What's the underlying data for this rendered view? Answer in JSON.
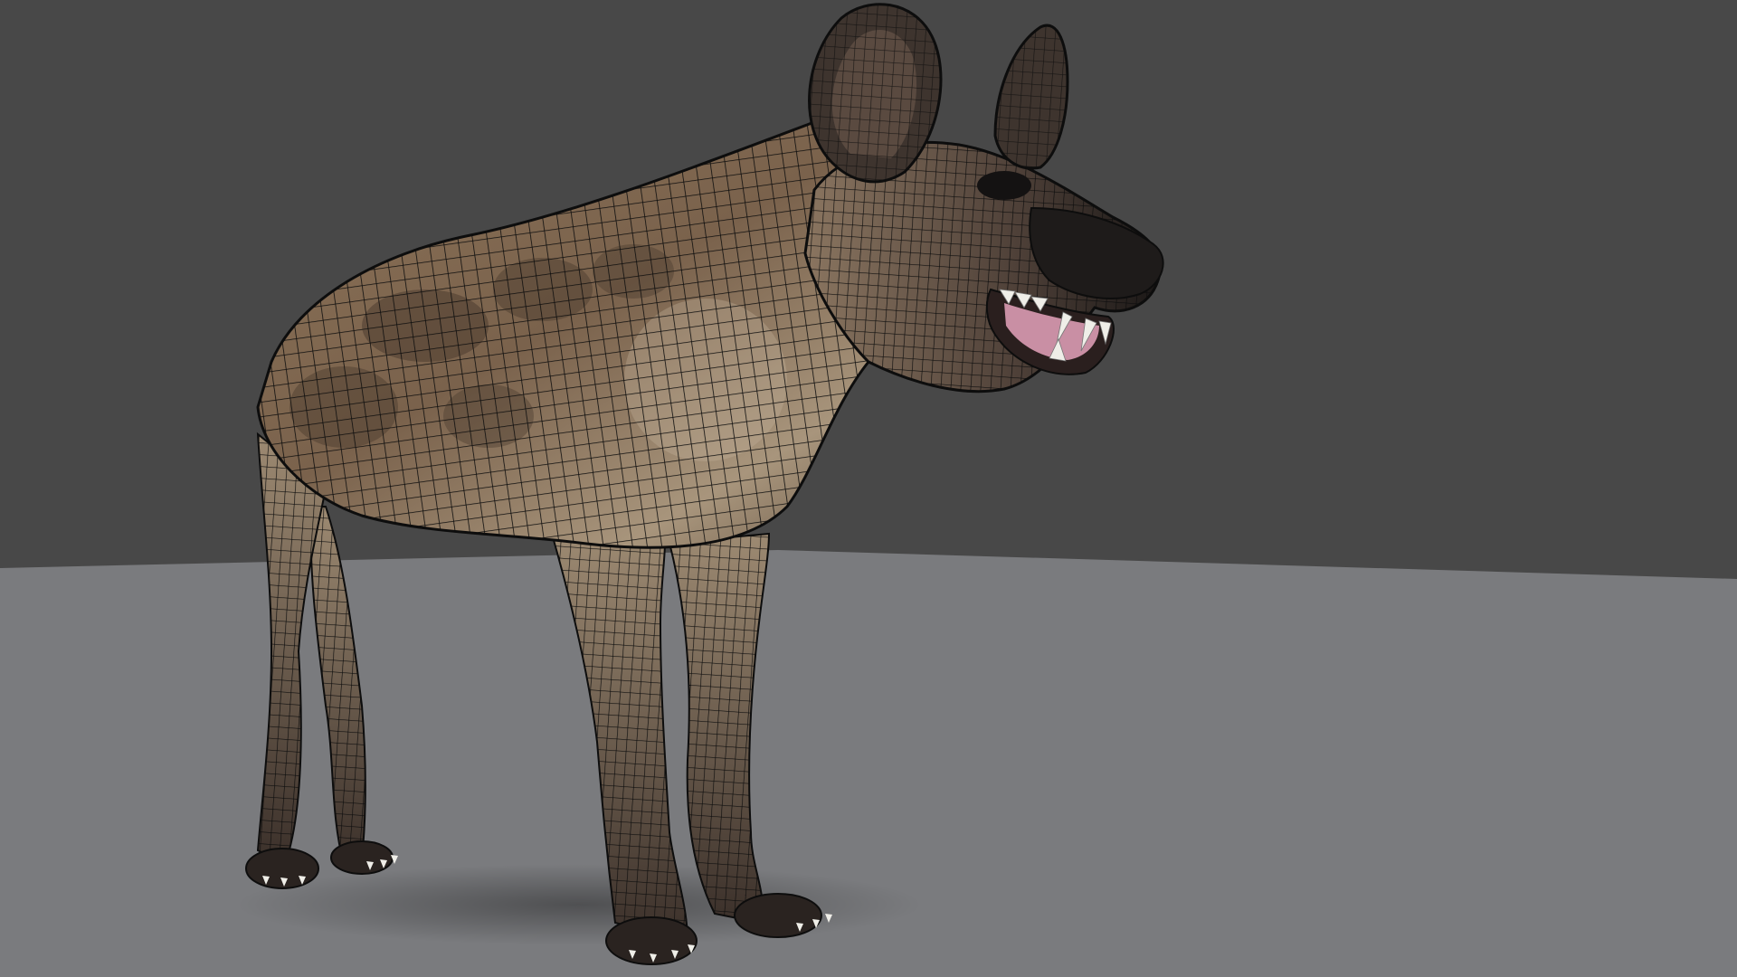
{
  "scene": {
    "kind": "3d-render-viewport",
    "subject": "spotted-hyena-model",
    "shading": "textured-with-wireframe-overlay",
    "colors": {
      "backdrop": "#484848",
      "floor": "#7a7b7e",
      "wire": "#0d0d0d",
      "fur_light": "#b3a188",
      "fur_mid": "#8c7358",
      "fur_dark": "#4d3d30",
      "muzzle": "#1e1b1a",
      "gum": "#c98fa4",
      "teeth": "#efeee8"
    }
  }
}
